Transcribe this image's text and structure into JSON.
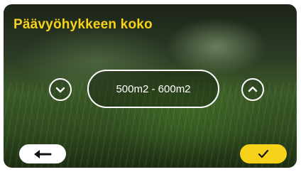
{
  "screen": {
    "title": "Päävyöhykkeen koko",
    "value": "500m2 - 600m2"
  },
  "icons": {
    "decrease": "chevron-down-icon",
    "increase": "chevron-up-icon",
    "back": "arrow-left-icon",
    "confirm": "checkmark-icon"
  },
  "colors": {
    "accent": "#f7d21a",
    "control_outline": "#ffffff",
    "back_button": "#ffffff"
  }
}
